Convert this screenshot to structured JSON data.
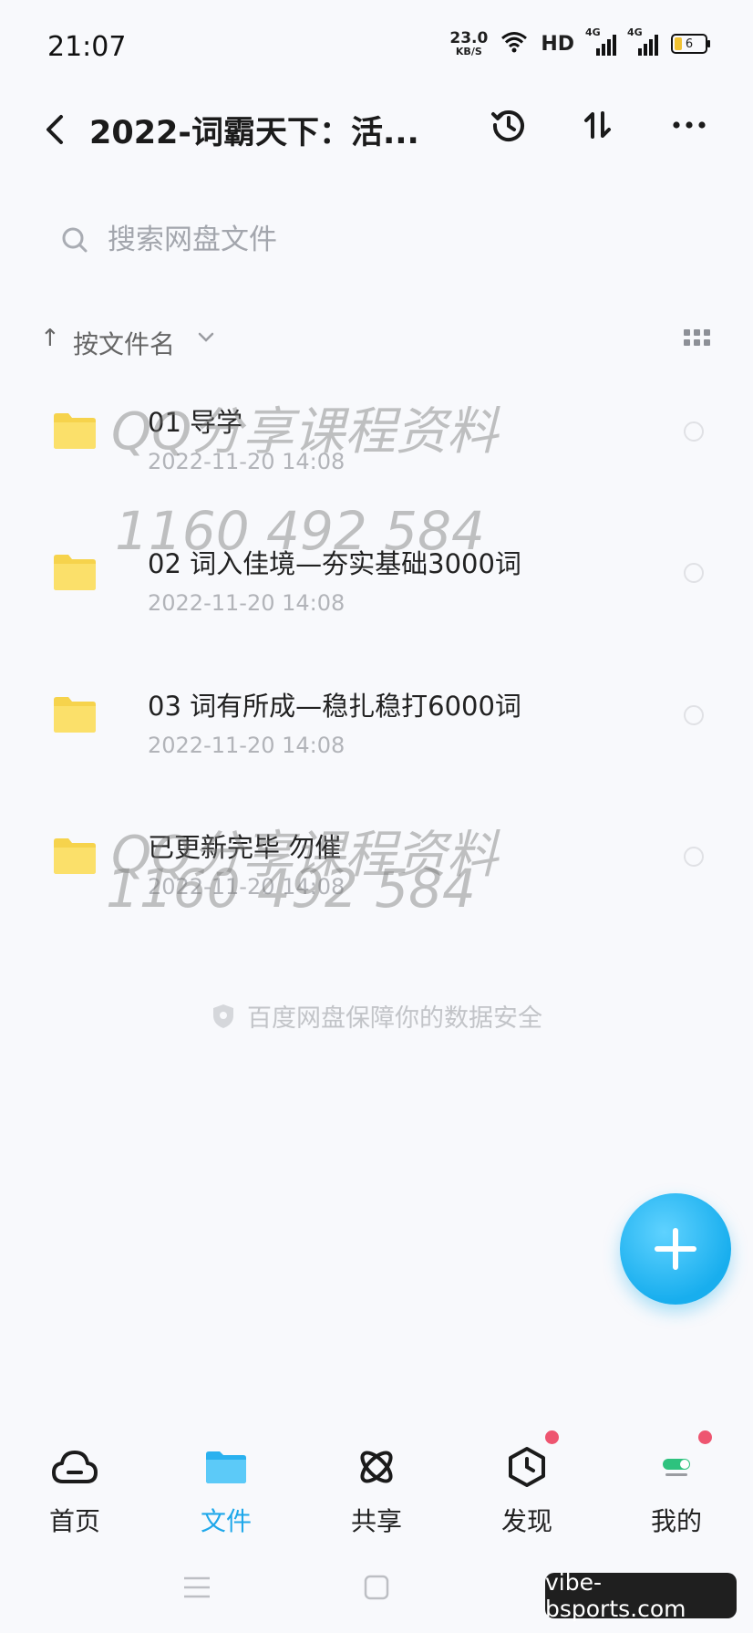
{
  "status_bar": {
    "time": "21:07",
    "net_speed_value": "23.0",
    "net_speed_unit": "KB/S",
    "hd_label": "HD",
    "signal_1_label": "4G",
    "signal_2_label": "4G",
    "battery_level": "6"
  },
  "header": {
    "title": "2022-词霸天下：活...",
    "icons": [
      "back-icon",
      "history-icon",
      "sort-icon",
      "more-icon"
    ]
  },
  "search": {
    "placeholder": "搜索网盘文件"
  },
  "sort": {
    "arrow": "↑",
    "label": "按文件名"
  },
  "files": [
    {
      "name": "01 导学",
      "date": "2022-11-20  14:08"
    },
    {
      "name": "02 词入佳境—夯实基础3000词",
      "date": "2022-11-20  14:08"
    },
    {
      "name": "03 词有所成—稳扎稳打6000词",
      "date": "2022-11-20  14:08"
    },
    {
      "name": "已更新完毕 勿催",
      "date": "2022-11-20  14:08"
    }
  ],
  "watermarks": [
    "QQ分享课程资料",
    "1160  492  584",
    "QQ分享课程资料",
    "1160  492  584"
  ],
  "safety_note": "百度网盘保障你的数据安全",
  "bottom_nav": [
    {
      "label": "首页",
      "icon": "home-cloud-icon",
      "active": false
    },
    {
      "label": "文件",
      "icon": "folder-icon",
      "active": true
    },
    {
      "label": "共享",
      "icon": "share-atom-icon",
      "active": false
    },
    {
      "label": "发现",
      "icon": "discover-cube-icon",
      "active": false
    },
    {
      "label": "我的",
      "icon": "profile-toggle-icon",
      "active": false
    }
  ],
  "corner_badge": "vibe-bsports.com",
  "colors": {
    "accent": "#1fa8ea",
    "folder": "#f6d34c",
    "badge_dot": "#ee5570"
  }
}
